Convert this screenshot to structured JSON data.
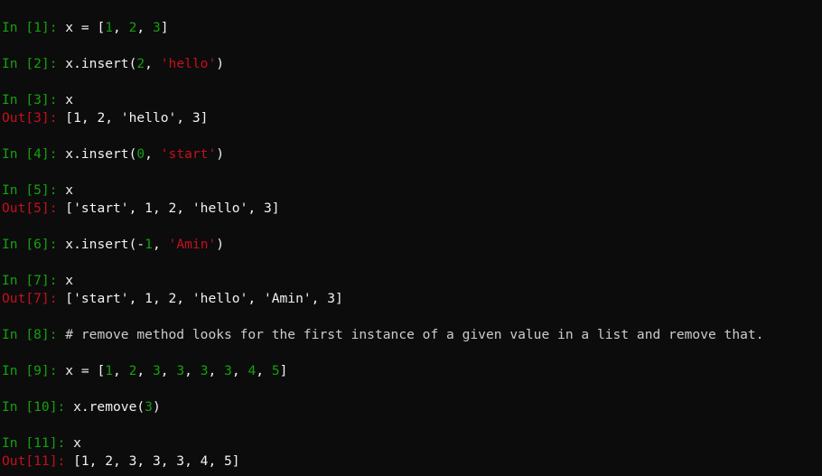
{
  "colors": {
    "background": "#0c0c0c",
    "text": "#f2f2f2",
    "in_prompt": "#13a10e",
    "out_prompt": "#c50f1f",
    "number": "#13a10e",
    "string": "#c50f1f",
    "comment": "#cccccc"
  },
  "lines": [
    {
      "prompt": "In [1]: ",
      "kind": "in",
      "tokens": [
        {
          "t": "code",
          "v": "x = ["
        },
        {
          "t": "num",
          "v": "1"
        },
        {
          "t": "code",
          "v": ", "
        },
        {
          "t": "num",
          "v": "2"
        },
        {
          "t": "code",
          "v": ", "
        },
        {
          "t": "num",
          "v": "3"
        },
        {
          "t": "code",
          "v": "]"
        }
      ]
    },
    {
      "prompt": "In [2]: ",
      "kind": "in",
      "tokens": [
        {
          "t": "code",
          "v": "x.insert("
        },
        {
          "t": "num",
          "v": "2"
        },
        {
          "t": "code",
          "v": ", "
        },
        {
          "t": "str",
          "v": "'hello'"
        },
        {
          "t": "code",
          "v": ")"
        }
      ]
    },
    {
      "prompt": "In [3]: ",
      "kind": "in",
      "tokens": [
        {
          "t": "code",
          "v": "x"
        }
      ]
    },
    {
      "prompt": "Out[3]: ",
      "kind": "out",
      "tokens": [
        {
          "t": "code",
          "v": "[1, 2, 'hello', 3]"
        }
      ]
    },
    {
      "prompt": "In [4]: ",
      "kind": "in",
      "tokens": [
        {
          "t": "code",
          "v": "x.insert("
        },
        {
          "t": "num",
          "v": "0"
        },
        {
          "t": "code",
          "v": ", "
        },
        {
          "t": "str",
          "v": "'start'"
        },
        {
          "t": "code",
          "v": ")"
        }
      ]
    },
    {
      "prompt": "In [5]: ",
      "kind": "in",
      "tokens": [
        {
          "t": "code",
          "v": "x"
        }
      ]
    },
    {
      "prompt": "Out[5]: ",
      "kind": "out",
      "tokens": [
        {
          "t": "code",
          "v": "['start', 1, 2, 'hello', 3]"
        }
      ]
    },
    {
      "prompt": "In [6]: ",
      "kind": "in",
      "tokens": [
        {
          "t": "code",
          "v": "x.insert(-"
        },
        {
          "t": "num",
          "v": "1"
        },
        {
          "t": "code",
          "v": ", "
        },
        {
          "t": "str",
          "v": "'Amin'"
        },
        {
          "t": "code",
          "v": ")"
        }
      ]
    },
    {
      "prompt": "In [7]: ",
      "kind": "in",
      "tokens": [
        {
          "t": "code",
          "v": "x"
        }
      ]
    },
    {
      "prompt": "Out[7]: ",
      "kind": "out",
      "tokens": [
        {
          "t": "code",
          "v": "['start', 1, 2, 'hello', 'Amin', 3]"
        }
      ]
    },
    {
      "prompt": "In [8]: ",
      "kind": "in",
      "tokens": [
        {
          "t": "comment",
          "v": "# remove method looks for the first instance of a given value in a list and remove that."
        }
      ]
    },
    {
      "prompt": "In [9]: ",
      "kind": "in",
      "tokens": [
        {
          "t": "code",
          "v": "x = ["
        },
        {
          "t": "num",
          "v": "1"
        },
        {
          "t": "code",
          "v": ", "
        },
        {
          "t": "num",
          "v": "2"
        },
        {
          "t": "code",
          "v": ", "
        },
        {
          "t": "num",
          "v": "3"
        },
        {
          "t": "code",
          "v": ", "
        },
        {
          "t": "num",
          "v": "3"
        },
        {
          "t": "code",
          "v": ", "
        },
        {
          "t": "num",
          "v": "3"
        },
        {
          "t": "code",
          "v": ", "
        },
        {
          "t": "num",
          "v": "3"
        },
        {
          "t": "code",
          "v": ", "
        },
        {
          "t": "num",
          "v": "4"
        },
        {
          "t": "code",
          "v": ", "
        },
        {
          "t": "num",
          "v": "5"
        },
        {
          "t": "code",
          "v": "]"
        }
      ]
    },
    {
      "prompt": "In [10]: ",
      "kind": "in",
      "tokens": [
        {
          "t": "code",
          "v": "x.remove("
        },
        {
          "t": "num",
          "v": "3"
        },
        {
          "t": "code",
          "v": ")"
        }
      ]
    },
    {
      "prompt": "In [11]: ",
      "kind": "in",
      "tokens": [
        {
          "t": "code",
          "v": "x"
        }
      ]
    },
    {
      "prompt": "Out[11]: ",
      "kind": "out",
      "tokens": [
        {
          "t": "code",
          "v": "[1, 2, 3, 3, 3, 4, 5]"
        }
      ]
    }
  ]
}
